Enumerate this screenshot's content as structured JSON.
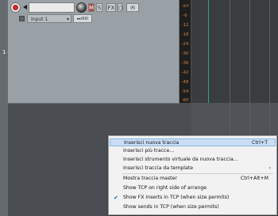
{
  "track": {
    "number": "1",
    "io_dot": "◦",
    "mute_label": "M",
    "solo_label": "S",
    "fx_label": "FX",
    "fx_bypass_label": "○",
    "env_label": "✉",
    "input_label": "Input 1",
    "monitor_label": "▸▸IIIIII"
  },
  "meter": {
    "scale": [
      "-inf",
      "-6",
      "-12",
      "-18",
      "-24",
      "-30",
      "-36",
      "-42",
      "-48",
      "-54",
      "-60"
    ]
  },
  "context_menu": {
    "items": [
      {
        "label": "Inserisci nuova traccia",
        "shortcut": "Ctrl+T",
        "highlighted": true
      },
      {
        "label": "Inserisci più tracce...",
        "shortcut": ""
      },
      {
        "label": "Inserisci strumento virtuale da nuova traccia...",
        "shortcut": ""
      },
      {
        "label": "Inserisci traccia da template",
        "shortcut": "",
        "submenu_arrow": "›"
      },
      {
        "label": "Mostra traccia master",
        "shortcut": "Ctrl+Alt+M"
      },
      {
        "label": "Show TCP on right side of arrange",
        "shortcut": ""
      },
      {
        "label": "Show FX inserts in TCP (when size permits)",
        "shortcut": "",
        "checked": true,
        "check_mark": "✔"
      },
      {
        "label": "Show sends in TCP (when size permits)",
        "shortcut": ""
      }
    ]
  },
  "colors": {
    "record_red": "#d52b2b",
    "highlight": "#c9def5",
    "meter_text": "#d68040",
    "play_cursor": "#33a870"
  }
}
